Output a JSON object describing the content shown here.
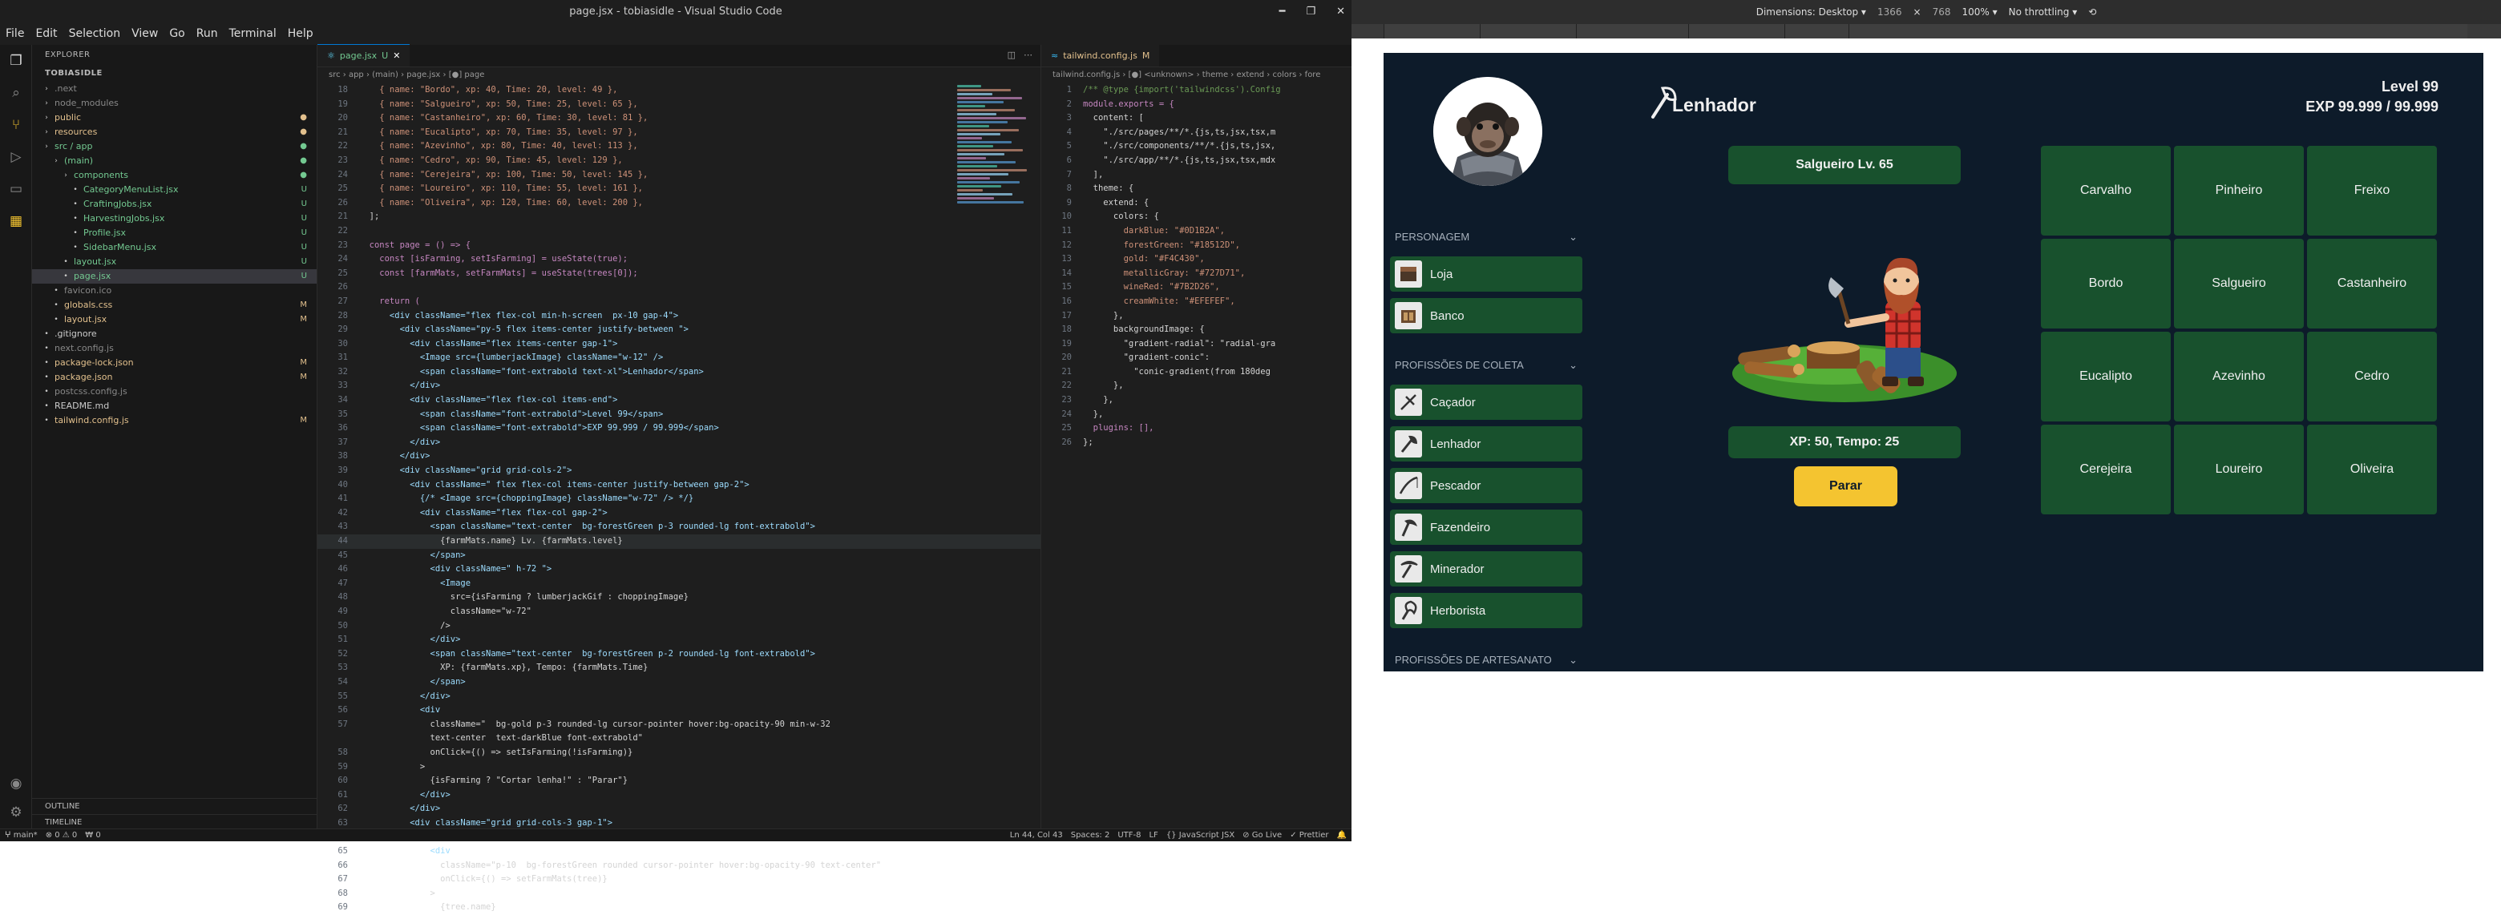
{
  "window": {
    "title": "page.jsx - tobiasidle - Visual Studio Code"
  },
  "menu": [
    "File",
    "Edit",
    "Selection",
    "View",
    "Go",
    "Run",
    "Terminal",
    "Help"
  ],
  "explorer": {
    "header": "EXPLORER",
    "root": "TOBIASIDLE",
    "files": [
      {
        "name": ".next",
        "indent": 1,
        "kind": "folder",
        "color": "#888",
        "status": ""
      },
      {
        "name": "node_modules",
        "indent": 1,
        "kind": "folder",
        "color": "#888",
        "status": ""
      },
      {
        "name": "public",
        "indent": 1,
        "kind": "folder",
        "color": "#e2c08d",
        "status": "●"
      },
      {
        "name": "resources",
        "indent": 1,
        "kind": "folder",
        "color": "#e2c08d",
        "status": "●"
      },
      {
        "name": "src / app",
        "indent": 1,
        "kind": "folder",
        "color": "#73c991",
        "status": "●"
      },
      {
        "name": "(main)",
        "indent": 2,
        "kind": "folder",
        "color": "#73c991",
        "status": "●"
      },
      {
        "name": "components",
        "indent": 3,
        "kind": "folder",
        "color": "#73c991",
        "status": "●"
      },
      {
        "name": "CategoryMenuList.jsx",
        "indent": 4,
        "kind": "file",
        "color": "#73c991",
        "status": "U"
      },
      {
        "name": "CraftingJobs.jsx",
        "indent": 4,
        "kind": "file",
        "color": "#73c991",
        "status": "U"
      },
      {
        "name": "HarvestingJobs.jsx",
        "indent": 4,
        "kind": "file",
        "color": "#73c991",
        "status": "U"
      },
      {
        "name": "Profile.jsx",
        "indent": 4,
        "kind": "file",
        "color": "#73c991",
        "status": "U"
      },
      {
        "name": "SidebarMenu.jsx",
        "indent": 4,
        "kind": "file",
        "color": "#73c991",
        "status": "U"
      },
      {
        "name": "layout.jsx",
        "indent": 3,
        "kind": "file",
        "color": "#73c991",
        "status": "U"
      },
      {
        "name": "page.jsx",
        "indent": 3,
        "kind": "file",
        "color": "#73c991",
        "status": "U",
        "active": true
      },
      {
        "name": "favicon.ico",
        "indent": 2,
        "kind": "file",
        "color": "#888",
        "status": ""
      },
      {
        "name": "globals.css",
        "indent": 2,
        "kind": "file",
        "color": "#e2c08d",
        "status": "M"
      },
      {
        "name": "layout.jsx",
        "indent": 2,
        "kind": "file",
        "color": "#e2c08d",
        "status": "M"
      },
      {
        "name": ".gitignore",
        "indent": 1,
        "kind": "file",
        "color": "#ccc",
        "status": ""
      },
      {
        "name": "next.config.js",
        "indent": 1,
        "kind": "file",
        "color": "#888",
        "status": ""
      },
      {
        "name": "package-lock.json",
        "indent": 1,
        "kind": "file",
        "color": "#e2c08d",
        "status": "M"
      },
      {
        "name": "package.json",
        "indent": 1,
        "kind": "file",
        "color": "#e2c08d",
        "status": "M"
      },
      {
        "name": "postcss.config.js",
        "indent": 1,
        "kind": "file",
        "color": "#888",
        "status": ""
      },
      {
        "name": "README.md",
        "indent": 1,
        "kind": "file",
        "color": "#ccc",
        "status": ""
      },
      {
        "name": "tailwind.config.js",
        "indent": 1,
        "kind": "file",
        "color": "#e2c08d",
        "status": "M"
      }
    ],
    "outline": "OUTLINE",
    "timeline": "TIMELINE"
  },
  "editor1": {
    "tab": "page.jsx",
    "tab_status": "U",
    "breadcrumb": "src › app › (main) › page.jsx › [●] page",
    "lines": [
      [
        18,
        "    { name: \"Bordo\", xp: 40, Time: 20, level: 49 },"
      ],
      [
        19,
        "    { name: \"Salgueiro\", xp: 50, Time: 25, level: 65 },"
      ],
      [
        20,
        "    { name: \"Castanheiro\", xp: 60, Time: 30, level: 81 },"
      ],
      [
        21,
        "    { name: \"Eucalipto\", xp: 70, Time: 35, level: 97 },"
      ],
      [
        22,
        "    { name: \"Azevinho\", xp: 80, Time: 40, level: 113 },"
      ],
      [
        23,
        "    { name: \"Cedro\", xp: 90, Time: 45, level: 129 },"
      ],
      [
        24,
        "    { name: \"Cerejeira\", xp: 100, Time: 50, level: 145 },"
      ],
      [
        25,
        "    { name: \"Loureiro\", xp: 110, Time: 55, level: 161 },"
      ],
      [
        26,
        "    { name: \"Oliveira\", xp: 120, Time: 60, level: 200 },"
      ],
      [
        21,
        "  ];"
      ],
      [
        22,
        ""
      ],
      [
        23,
        "  const page = () => {"
      ],
      [
        24,
        "    const [isFarming, setIsFarming] = useState(true);"
      ],
      [
        25,
        "    const [farmMats, setFarmMats] = useState(trees[0]);"
      ],
      [
        26,
        ""
      ],
      [
        27,
        "    return ("
      ],
      [
        28,
        "      <div className=\"flex flex-col min-h-screen  px-10 gap-4\">"
      ],
      [
        29,
        "        <div className=\"py-5 flex items-center justify-between \">"
      ],
      [
        30,
        "          <div className=\"flex items-center gap-1\">"
      ],
      [
        31,
        "            <Image src={lumberjackImage} className=\"w-12\" />"
      ],
      [
        32,
        "            <span className=\"font-extrabold text-xl\">Lenhador</span>"
      ],
      [
        33,
        "          </div>"
      ],
      [
        34,
        "          <div className=\"flex flex-col items-end\">"
      ],
      [
        35,
        "            <span className=\"font-extrabold\">Level 99</span>"
      ],
      [
        36,
        "            <span className=\"font-extrabold\">EXP 99.999 / 99.999</span>"
      ],
      [
        37,
        "          </div>"
      ],
      [
        38,
        "        </div>"
      ],
      [
        39,
        "        <div className=\"grid grid-cols-2\">"
      ],
      [
        40,
        "          <div className=\" flex flex-col items-center justify-between gap-2\">"
      ],
      [
        41,
        "            {/* <Image src={choppingImage} className=\"w-72\" /> */}"
      ],
      [
        42,
        "            <div className=\"flex flex-col gap-2\">"
      ],
      [
        43,
        "              <span className=\"text-center  bg-forestGreen p-3 rounded-lg font-extrabold\">"
      ],
      [
        44,
        "                {farmMats.name} Lv. {farmMats.level}"
      ],
      [
        45,
        "              </span>"
      ],
      [
        46,
        "              <div className=\" h-72 \">"
      ],
      [
        47,
        "                <Image"
      ],
      [
        48,
        "                  src={isFarming ? lumberjackGif : choppingImage}"
      ],
      [
        49,
        "                  className=\"w-72\""
      ],
      [
        50,
        "                />"
      ],
      [
        51,
        "              </div>"
      ],
      [
        52,
        "              <span className=\"text-center  bg-forestGreen p-2 rounded-lg font-extrabold\">"
      ],
      [
        53,
        "                XP: {farmMats.xp}, Tempo: {farmMats.Time}"
      ],
      [
        54,
        "              </span>"
      ],
      [
        55,
        "            </div>"
      ],
      [
        56,
        "            <div"
      ],
      [
        57,
        "              className=\"  bg-gold p-3 rounded-lg cursor-pointer hover:bg-opacity-90 min-w-32"
      ],
      [
        " ",
        "              text-center  text-darkBlue font-extrabold\""
      ],
      [
        58,
        "              onClick={() => setIsFarming(!isFarming)}"
      ],
      [
        59,
        "            >"
      ],
      [
        60,
        "              {isFarming ? \"Cortar lenha!\" : \"Parar\"}"
      ],
      [
        61,
        "            </div>"
      ],
      [
        62,
        "          </div>"
      ],
      [
        63,
        "          <div className=\"grid grid-cols-3 gap-1\">"
      ],
      [
        64,
        "            {trees.map((tree) => ("
      ],
      [
        65,
        "              <div"
      ],
      [
        66,
        "                className=\"p-10  bg-forestGreen rounded cursor-pointer hover:bg-opacity-90 text-center\""
      ],
      [
        67,
        "                onClick={() => setFarmMats(tree)}"
      ],
      [
        68,
        "              >"
      ],
      [
        69,
        "                {tree.name}"
      ]
    ]
  },
  "editor2": {
    "tab": "tailwind.config.js",
    "tab_status": "M",
    "breadcrumb": "tailwind.config.js › [●] <unknown> › theme › extend › colors › fore",
    "lines": [
      [
        1,
        "/** @type {import('tailwindcss').Config"
      ],
      [
        2,
        "module.exports = {"
      ],
      [
        3,
        "  content: ["
      ],
      [
        4,
        "    \"./src/pages/**/*.{js,ts,jsx,tsx,m"
      ],
      [
        5,
        "    \"./src/components/**/*.{js,ts,jsx,"
      ],
      [
        6,
        "    \"./src/app/**/*.{js,ts,jsx,tsx,mdx"
      ],
      [
        7,
        "  ],"
      ],
      [
        8,
        "  theme: {"
      ],
      [
        9,
        "    extend: {"
      ],
      [
        10,
        "      colors: {"
      ],
      [
        11,
        "        darkBlue: \"#0D1B2A\","
      ],
      [
        12,
        "        forestGreen: \"#18512D\","
      ],
      [
        13,
        "        gold: \"#F4C430\","
      ],
      [
        14,
        "        metallicGray: \"#727D71\","
      ],
      [
        15,
        "        wineRed: \"#7B2D26\","
      ],
      [
        16,
        "        creamWhite: \"#EFEFEF\","
      ],
      [
        17,
        "      },"
      ],
      [
        18,
        "      backgroundImage: {"
      ],
      [
        19,
        "        \"gradient-radial\": \"radial-gra"
      ],
      [
        20,
        "        \"gradient-conic\":"
      ],
      [
        21,
        "          \"conic-gradient(from 180deg"
      ],
      [
        22,
        "      },"
      ],
      [
        23,
        "    },"
      ],
      [
        24,
        "  },"
      ],
      [
        25,
        "  plugins: [],"
      ],
      [
        26,
        "};"
      ]
    ]
  },
  "statusbar": {
    "left": [
      "ⵖ main*",
      "⊗ 0 ⚠ 0",
      "₩ 0"
    ],
    "right": [
      "Ln 44, Col 43",
      "Spaces: 2",
      "UTF-8",
      "LF",
      "{} JavaScript JSX",
      "⊘ Go Live",
      "✓ Prettier",
      "🔔"
    ]
  },
  "devtools": {
    "dimensions": "Dimensions: Desktop ▾",
    "width": "1366",
    "x": "×",
    "height": "768",
    "zoom": "100% ▾",
    "throttle": "No throttling ▾"
  },
  "app": {
    "colors": {
      "darkBlue": "#0D1B2A",
      "forestGreen": "#18512D",
      "gold": "#F4C430",
      "creamWhite": "#EFEFEF"
    },
    "header": {
      "title": "Lenhador",
      "level": "Level 99",
      "exp": "EXP 99.999 / 99.999"
    },
    "sections": [
      {
        "title": "PERSONAGEM",
        "items": [
          {
            "label": "Loja",
            "icon": "shop-icon"
          },
          {
            "label": "Banco",
            "icon": "bank-icon"
          }
        ]
      },
      {
        "title": "PROFISSÕES DE COLETA",
        "items": [
          {
            "label": "Caçador",
            "icon": "hunter-icon"
          },
          {
            "label": "Lenhador",
            "icon": "axe-icon"
          },
          {
            "label": "Pescador",
            "icon": "fishing-rod-icon"
          },
          {
            "label": "Fazendeiro",
            "icon": "scythe-icon"
          },
          {
            "label": "Minerador",
            "icon": "pickaxe-icon"
          },
          {
            "label": "Herborista",
            "icon": "herb-sickle-icon"
          }
        ]
      },
      {
        "title": "PROFISSÕES DE ARTESANATO",
        "items": []
      }
    ],
    "farm": {
      "title": "Salgueiro Lv. 65",
      "stats": "XP: 50, Tempo: 25",
      "button": "Parar"
    },
    "trees": [
      "Carvalho",
      "Pinheiro",
      "Freixo",
      "Bordo",
      "Salgueiro",
      "Castanheiro",
      "Eucalipto",
      "Azevinho",
      "Cedro",
      "Cerejeira",
      "Loureiro",
      "Oliveira"
    ]
  }
}
